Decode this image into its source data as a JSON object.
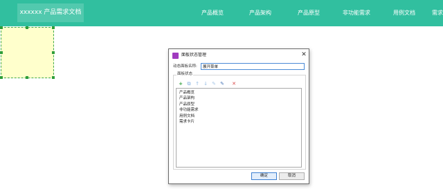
{
  "header": {
    "brand": "xxxxxx 产品需求文档",
    "nav": [
      {
        "label": "产品概览"
      },
      {
        "label": "产品架构"
      },
      {
        "label": "产品原型"
      },
      {
        "label": "非功能需求"
      },
      {
        "label": "用例文档"
      },
      {
        "label": "需求卡片"
      }
    ]
  },
  "dialog": {
    "title": "面板状态管理",
    "name_label": "动态面板名称:",
    "name_value": "展开菜单",
    "group_label": "面板状态",
    "toolbar": {
      "add": "+",
      "copy": "⧉",
      "up": "↑",
      "down": "↓",
      "edit": "✎",
      "edit_all": "✎",
      "delete": "✕"
    },
    "states": [
      "产品概览",
      "产品架构",
      "产品原型",
      "非功能需求",
      "用例文档",
      "需求卡片"
    ],
    "ok_label": "确定",
    "cancel_label": "取消"
  },
  "colors": {
    "header_bg": "#31bf9f",
    "selection_fill": "#ffffcc",
    "selection_handle": "#2e9e3a",
    "dialog_icon": "#a03bbf",
    "add_icon": "#2e9e3a",
    "delete_icon": "#d94a4a",
    "disabled_icon": "#a9c8e8"
  }
}
